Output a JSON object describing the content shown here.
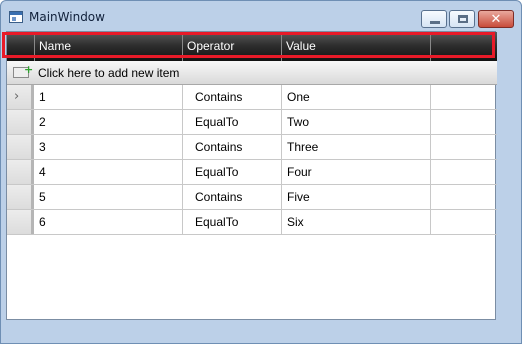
{
  "window": {
    "title": "MainWindow"
  },
  "grid": {
    "columns": [
      "Name",
      "Operator",
      "Value"
    ],
    "new_item_label": "Click here to add new item",
    "rows": [
      {
        "name": "1",
        "operator": "Contains",
        "value": "One"
      },
      {
        "name": "2",
        "operator": "EqualTo",
        "value": "Two"
      },
      {
        "name": "3",
        "operator": "Contains",
        "value": "Three"
      },
      {
        "name": "4",
        "operator": "EqualTo",
        "value": "Four"
      },
      {
        "name": "5",
        "operator": "Contains",
        "value": "Five"
      },
      {
        "name": "6",
        "operator": "EqualTo",
        "value": "Six"
      }
    ]
  },
  "icons": {
    "current_row_indicator": "chevron-right-icon",
    "add_item": "add-item-icon"
  },
  "colors": {
    "highlight": "#e81a28",
    "header": "#111111"
  }
}
